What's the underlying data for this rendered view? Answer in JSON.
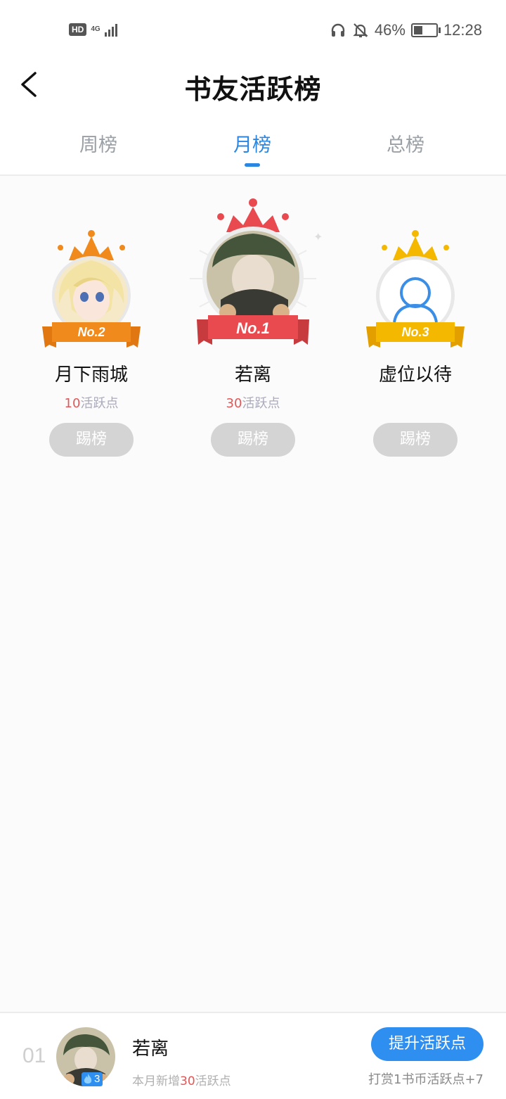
{
  "status": {
    "hd": "HD",
    "net": "4G",
    "battery": "46%",
    "battery_level": 0.46,
    "time": "12:28"
  },
  "header": {
    "title": "书友活跃榜"
  },
  "tabs": [
    {
      "label": "周榜",
      "active": false
    },
    {
      "label": "月榜",
      "active": true
    },
    {
      "label": "总榜",
      "active": false
    }
  ],
  "podium": {
    "first": {
      "badge": "No.1",
      "name": "若离",
      "points": "30",
      "points_suffix": "活跃点",
      "button": "踢榜"
    },
    "second": {
      "badge": "No.2",
      "name": "月下雨城",
      "points": "10",
      "points_suffix": "活跃点",
      "button": "踢榜"
    },
    "third": {
      "badge": "No.3",
      "name": "虚位以待",
      "button": "踢榜"
    }
  },
  "me": {
    "rank": "01",
    "name": "若离",
    "level": "3",
    "sub_prefix": "本月新增",
    "sub_points": "30",
    "sub_suffix": "活跃点",
    "boost_button": "提升活跃点",
    "tip": "打赏1书币活跃点+7"
  },
  "colors": {
    "accent": "#2a86e0",
    "gold": "#f5b800",
    "silver_orange": "#f08a1c",
    "red": "#e84a4f",
    "points_red": "#e25757"
  }
}
